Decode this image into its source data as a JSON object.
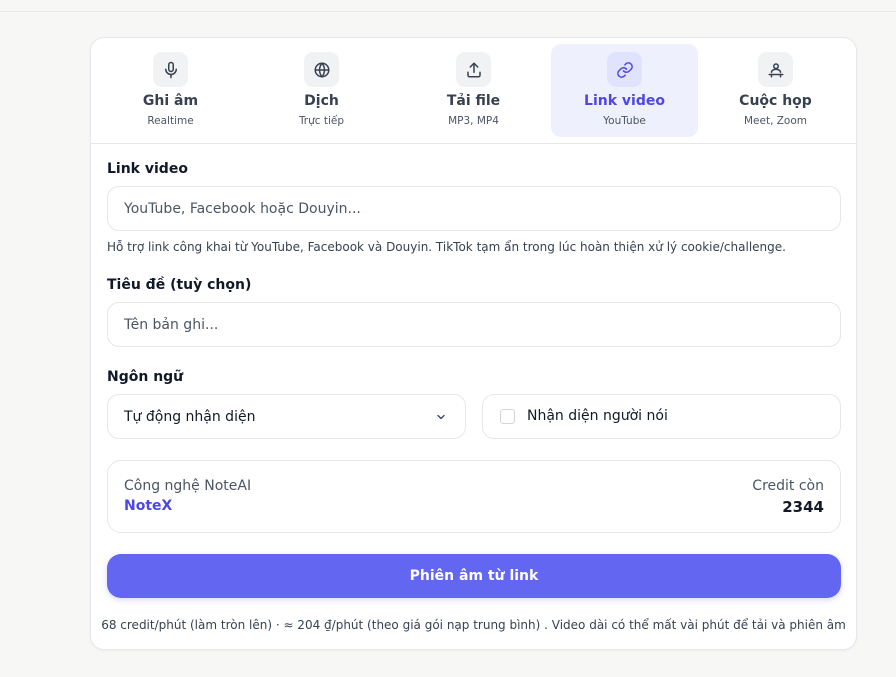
{
  "tabs": [
    {
      "label": "Ghi âm",
      "sub": "Realtime",
      "icon": "microphone-icon"
    },
    {
      "label": "Dịch",
      "sub": "Trực tiếp",
      "icon": "globe-icon"
    },
    {
      "label": "Tải file",
      "sub": "MP3, MP4",
      "icon": "upload-icon"
    },
    {
      "label": "Link video",
      "sub": "YouTube",
      "icon": "link-icon"
    },
    {
      "label": "Cuộc họp",
      "sub": "Meet, Zoom",
      "icon": "meeting-icon"
    }
  ],
  "active_tab": "Link video",
  "accent_color": "#6366f1",
  "form": {
    "link_label": "Link video",
    "link_placeholder": "YouTube, Facebook hoặc Douyin...",
    "link_hint": "Hỗ trợ link công khai từ YouTube, Facebook và Douyin. TikTok tạm ẩn trong lúc hoàn thiện xử lý cookie/challenge.",
    "title_label": "Tiêu đề (tuỳ chọn)",
    "title_placeholder": "Tên bản ghi...",
    "language_label": "Ngôn ngữ",
    "language_value": "Tự động nhận diện",
    "speaker_label": "Nhận diện người nói",
    "speaker_checked": false
  },
  "tech": {
    "label": "Công nghệ NoteAI",
    "value": "NoteX",
    "credit_label": "Credit còn",
    "credit_value": "2344"
  },
  "submit_label": "Phiên âm từ link",
  "footnote": "68 credit/phút (làm tròn lên) · ≈ 204 ₫/phút (theo giá gói nạp trung bình) . Video dài có thể mất vài phút để tải và phiên âm"
}
